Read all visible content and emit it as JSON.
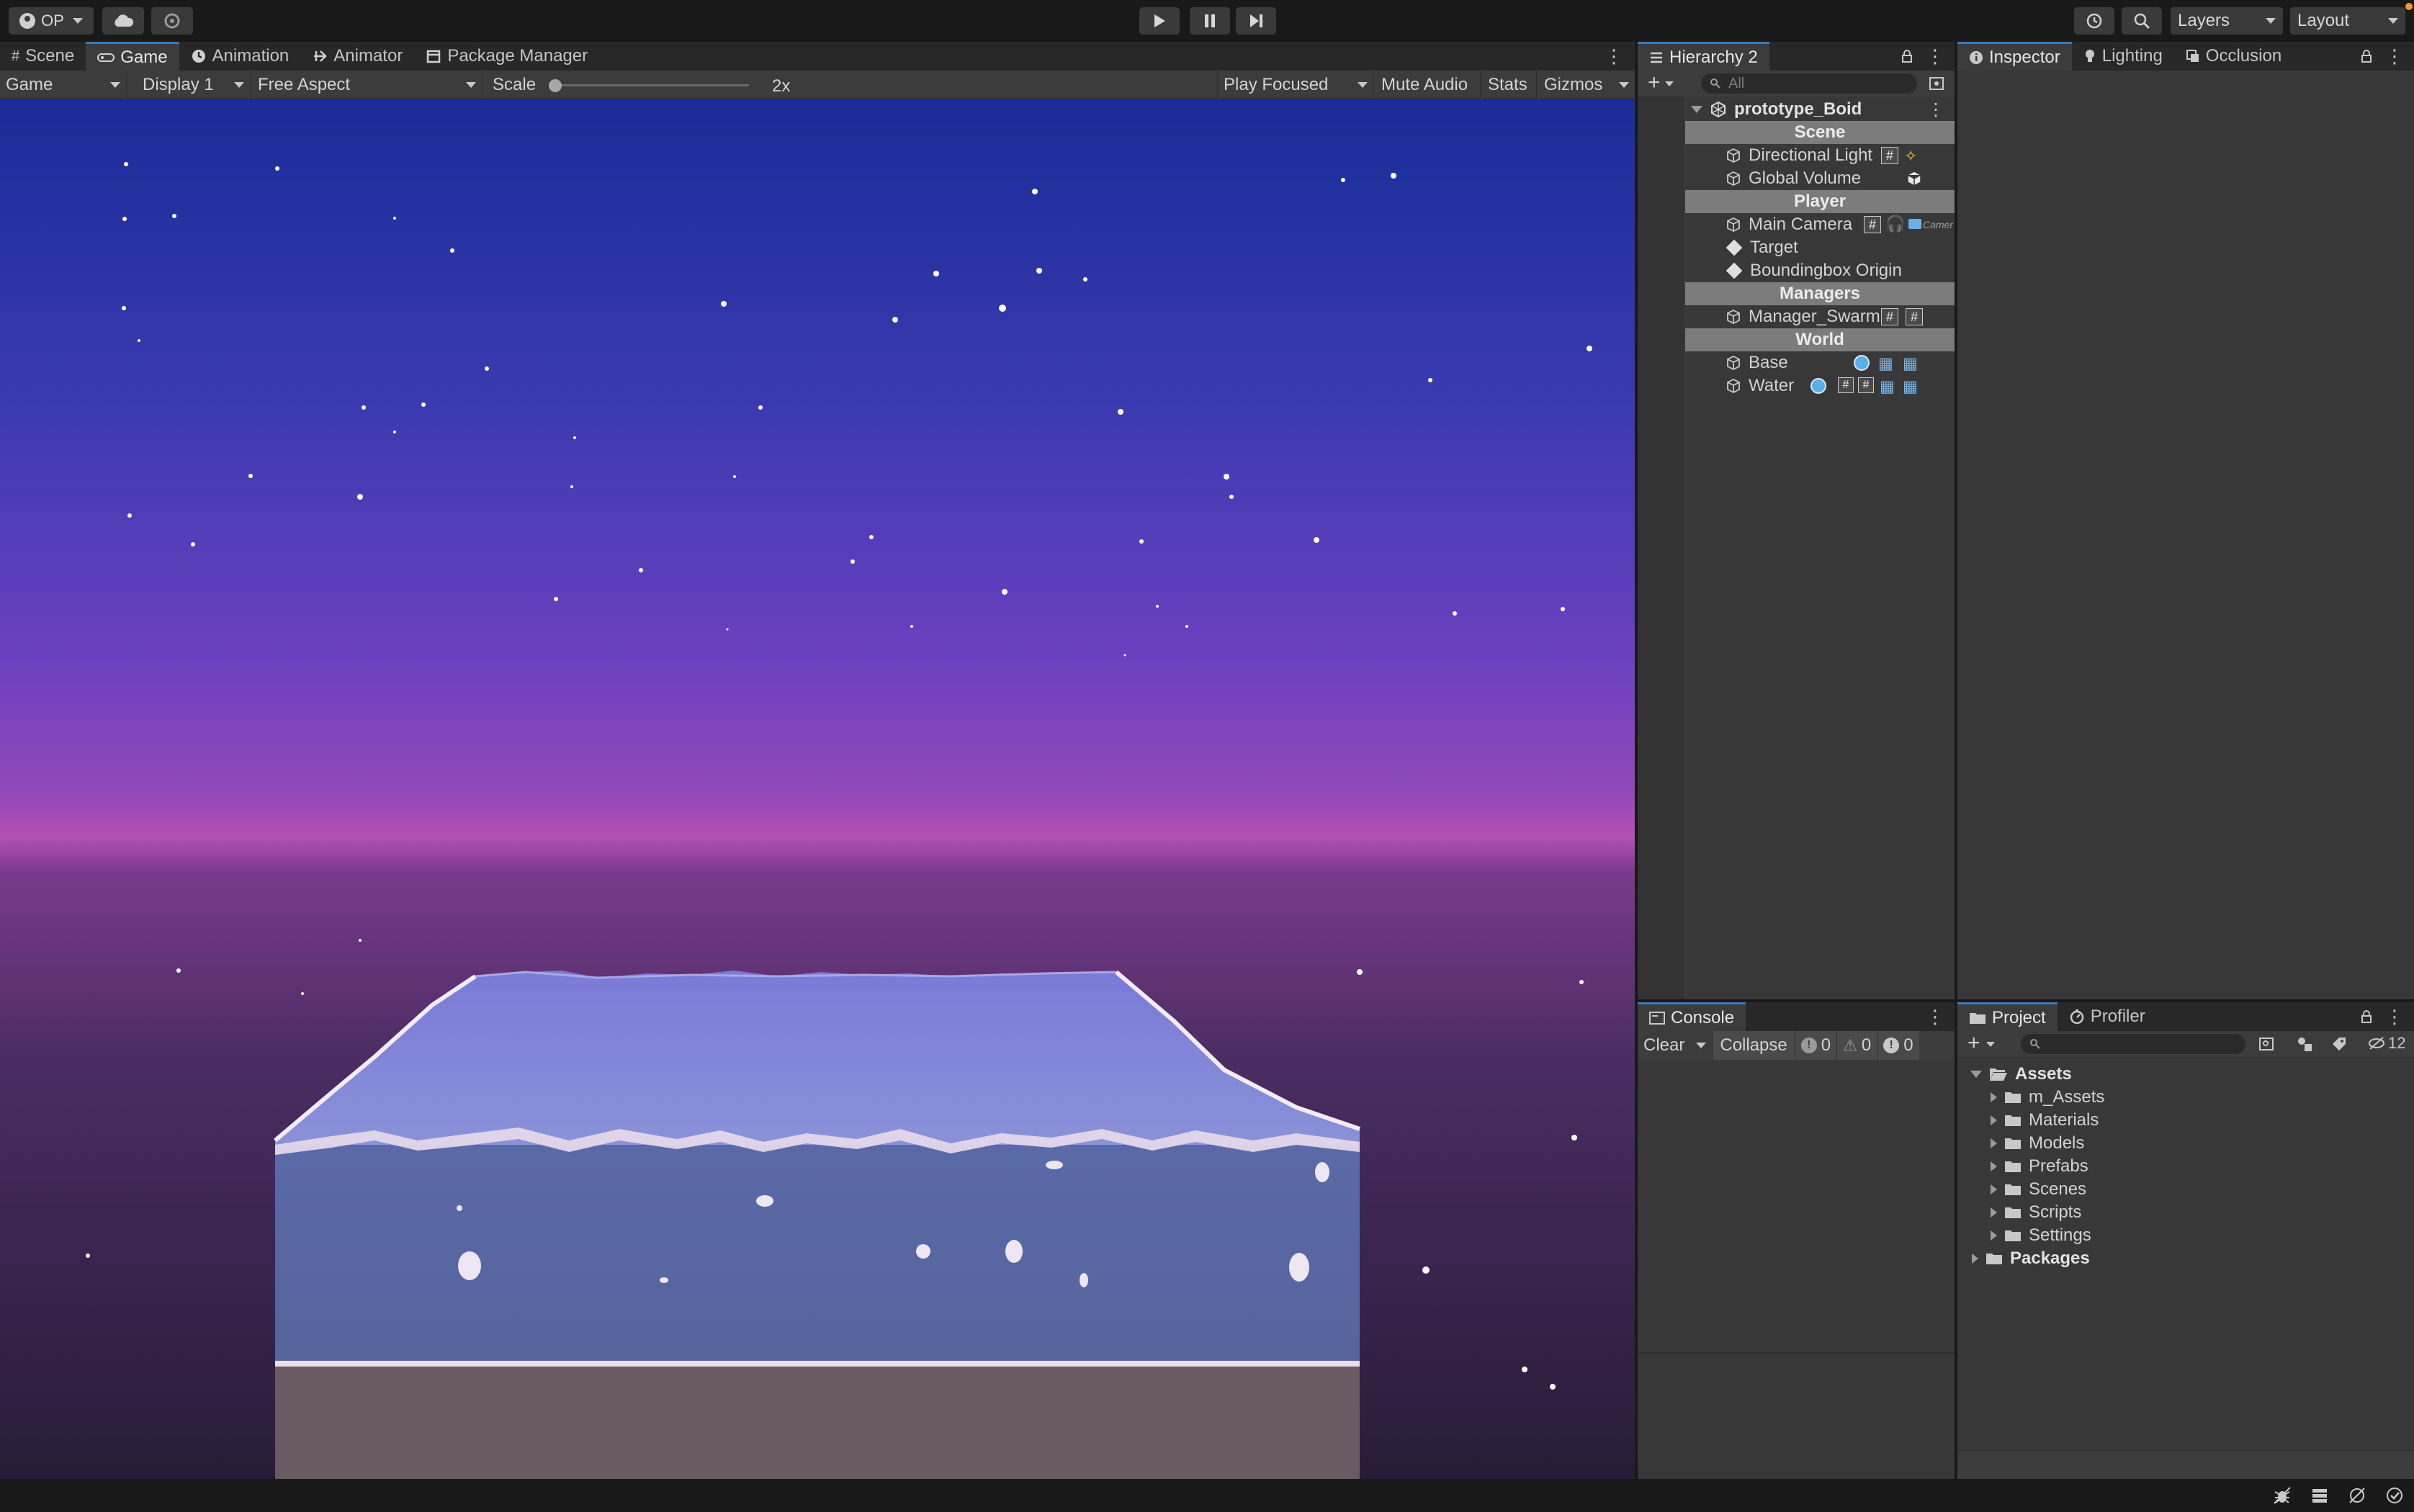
{
  "toolbar": {
    "account_label": "OP",
    "layers_label": "Layers",
    "layout_label": "Layout",
    "play_icon": "play-icon",
    "pause_icon": "pause-icon",
    "step_icon": "step-icon"
  },
  "main_tabs": [
    {
      "label": "Scene",
      "icon": "scene-grid-icon"
    },
    {
      "label": "Game",
      "icon": "game-controller-icon"
    },
    {
      "label": "Animation",
      "icon": "animation-clock-icon"
    },
    {
      "label": "Animator",
      "icon": "animator-icon"
    },
    {
      "label": "Package Manager",
      "icon": "package-icon"
    }
  ],
  "game_toolbar": {
    "mode": "Game",
    "display": "Display 1",
    "aspect": "Free Aspect",
    "scale_label": "Scale",
    "scale_value": "2x",
    "play_focused": "Play Focused",
    "mute_audio": "Mute Audio",
    "stats": "Stats",
    "gizmos": "Gizmos"
  },
  "hierarchy": {
    "tab_label": "Hierarchy 2",
    "search_placeholder": "All",
    "root": "prototype_Boid",
    "rows": [
      {
        "type": "header",
        "label": "Scene"
      },
      {
        "type": "item",
        "label": "Directional Light"
      },
      {
        "type": "item",
        "label": "Global Volume"
      },
      {
        "type": "header",
        "label": "Player"
      },
      {
        "type": "item",
        "label": "Main Camera"
      },
      {
        "type": "item",
        "label": "Target"
      },
      {
        "type": "item",
        "label": "Boundingbox Origin"
      },
      {
        "type": "header",
        "label": "Managers"
      },
      {
        "type": "item",
        "label": "Manager_Swarm"
      },
      {
        "type": "header",
        "label": "World"
      },
      {
        "type": "item",
        "label": "Base"
      },
      {
        "type": "item",
        "label": "Water"
      }
    ],
    "camera_badge": "Camer"
  },
  "inspector_tabs": [
    {
      "label": "Inspector",
      "icon": "info-icon"
    },
    {
      "label": "Lighting",
      "icon": "bulb-icon"
    },
    {
      "label": "Occlusion",
      "icon": "occlusion-icon"
    }
  ],
  "console": {
    "tab_label": "Console",
    "clear": "Clear",
    "collapse": "Collapse",
    "info_count": "0",
    "warn_count": "0",
    "error_count": "0"
  },
  "project": {
    "tabs": [
      {
        "label": "Project",
        "icon": "folder-icon"
      },
      {
        "label": "Profiler",
        "icon": "profiler-icon"
      }
    ],
    "hidden_count": "12",
    "tree": [
      {
        "label": "Assets",
        "level": 0,
        "bold": true,
        "expanded": true
      },
      {
        "label": "m_Assets",
        "level": 1
      },
      {
        "label": "Materials",
        "level": 1
      },
      {
        "label": "Models",
        "level": 1
      },
      {
        "label": "Prefabs",
        "level": 1
      },
      {
        "label": "Scenes",
        "level": 1
      },
      {
        "label": "Scripts",
        "level": 1
      },
      {
        "label": "Settings",
        "level": 1
      },
      {
        "label": "Packages",
        "level": 0,
        "bold": true,
        "expanded": false
      }
    ]
  },
  "colors": {
    "accent": "#3a79bb",
    "panel": "#383838",
    "header_row": "#7c7c7c",
    "sky_top": "#1a2a9a",
    "sky_mid": "#7040c0",
    "horizon": "#b050b8",
    "ground": "#2c1e3a"
  }
}
